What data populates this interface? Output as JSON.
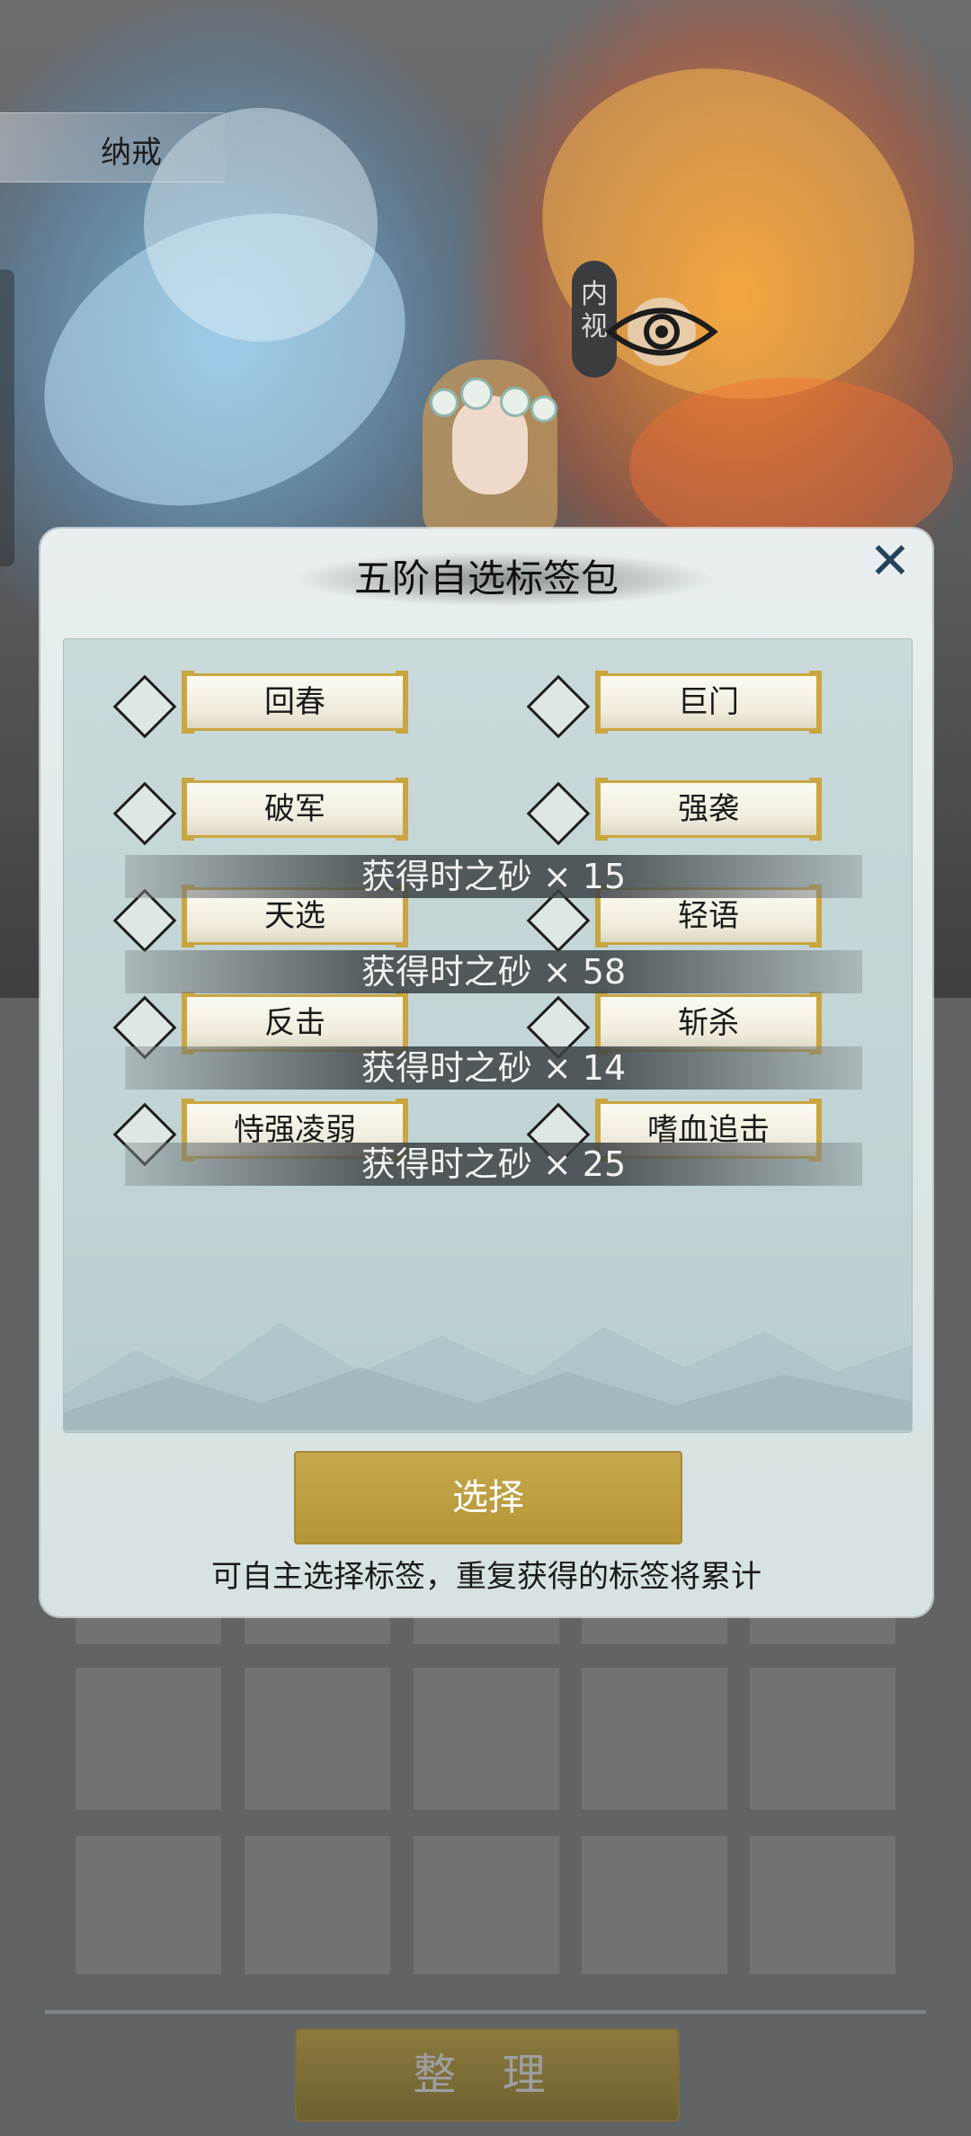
{
  "header": {
    "tab_label": "纳戒"
  },
  "scene": {
    "inner_view_label": "内视"
  },
  "dialog": {
    "title": "五阶自选标签包",
    "close_label": "✕",
    "options": [
      {
        "label": "回春"
      },
      {
        "label": "巨门"
      },
      {
        "label": "破军"
      },
      {
        "label": "强袭"
      },
      {
        "label": "天选"
      },
      {
        "label": "轻语"
      },
      {
        "label": "反击"
      },
      {
        "label": "斩杀"
      },
      {
        "label": "恃强凌弱"
      },
      {
        "label": "嗜血追击"
      }
    ],
    "rewards": [
      {
        "text": "获得时之砂 × 15"
      },
      {
        "text": "获得时之砂 × 58"
      },
      {
        "text": "获得时之砂 × 14"
      },
      {
        "text": "获得时之砂 × 25"
      }
    ],
    "select_label": "选择",
    "hint": "可自主选择标签，重复获得的标签将累计"
  },
  "footer": {
    "tidy_label": "整 理"
  },
  "colors": {
    "gold": "#c9a640",
    "panel": "#c4d6d7",
    "dialog": "#e4ecec"
  }
}
